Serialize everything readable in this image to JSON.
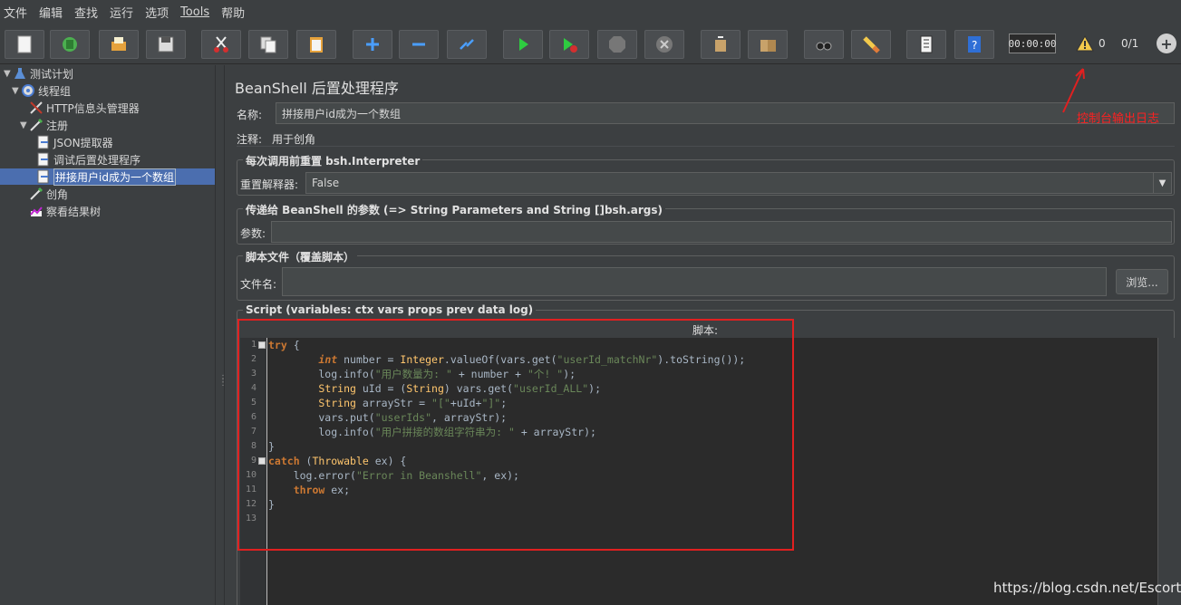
{
  "menu": [
    "文件",
    "编辑",
    "查找",
    "运行",
    "选项",
    "Tools",
    "帮助"
  ],
  "toolbar": {
    "icons": [
      "new-icon",
      "templates-icon",
      "open-icon",
      "save-icon",
      "cut-icon",
      "copy-icon",
      "paste-icon",
      "expand-icon",
      "collapse-icon",
      "toggle-icon",
      "start-icon",
      "start-no-pause-icon",
      "stop-icon",
      "shutdown-icon",
      "clear-icon",
      "clear-all-icon",
      "search-icon",
      "reset-search-icon",
      "function-helper-icon",
      "help-icon"
    ],
    "timer": "00:00:00",
    "warning_count": "0",
    "threads": "0/1"
  },
  "tree": {
    "items": [
      {
        "label": "测试计划",
        "icon": "test-plan-icon"
      },
      {
        "label": "线程组",
        "icon": "thread-group-icon"
      },
      {
        "label": "HTTP信息头管理器",
        "icon": "header-manager-icon"
      },
      {
        "label": "注册",
        "icon": "sampler-icon"
      },
      {
        "label": "JSON提取器",
        "icon": "post-processor-icon"
      },
      {
        "label": "调试后置处理程序",
        "icon": "post-processor-icon"
      },
      {
        "label": "拼接用户id成为一个数组",
        "icon": "post-processor-icon"
      },
      {
        "label": "创角",
        "icon": "sampler-icon"
      },
      {
        "label": "察看结果树",
        "icon": "listener-icon"
      }
    ]
  },
  "panel": {
    "title": "BeanShell 后置处理程序",
    "name_label": "名称:",
    "name_value": "拼接用户id成为一个数组",
    "comment_label": "注释:",
    "comment_value": "用于创角",
    "reset_group": "每次调用前重置 bsh.Interpreter",
    "reset_label": "重置解释器:",
    "reset_value": "False",
    "params_group": "传递给 BeanShell 的参数 (=> String Parameters and String []bsh.args)",
    "params_label": "参数:",
    "params_value": "",
    "file_group": "脚本文件（覆盖脚本）",
    "file_label": "文件名:",
    "file_value": "",
    "browse_label": "浏览...",
    "script_group": "Script (variables: ctx vars props prev data log)",
    "script_label": "脚本:"
  },
  "script_lines": [
    "1",
    "2",
    "3",
    "4",
    "5",
    "6",
    "7",
    "8",
    "9",
    "10",
    "11",
    "12",
    "13"
  ],
  "annotation": "控制台输出日志",
  "watermark": "https://blog.csdn.net/Escorts",
  "colors": {
    "background": "#3c3f41",
    "editor_bg": "#2b2b2b",
    "selection": "#4b6eaf",
    "annotation_red": "#e02020",
    "keyword": "#cc7832",
    "string": "#6a8759"
  }
}
